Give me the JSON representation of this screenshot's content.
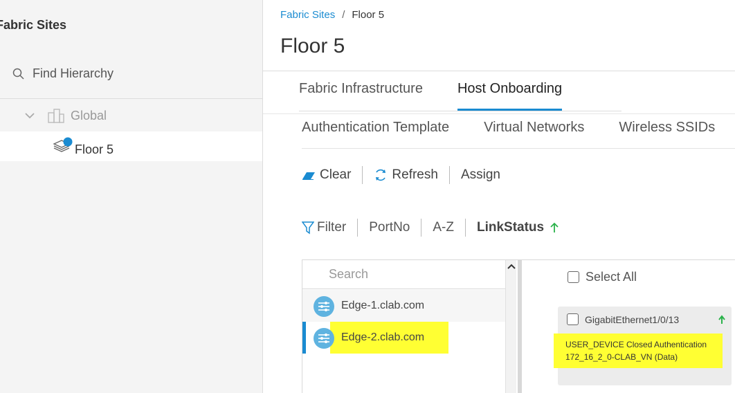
{
  "sidebar": {
    "title": "Fabric Sites",
    "find_label": "Find Hierarchy",
    "tree": {
      "global": "Global",
      "floor": "Floor 5"
    }
  },
  "breadcrumb": {
    "parent": "Fabric Sites",
    "separator": "/",
    "current": "Floor 5"
  },
  "page_title": "Floor 5",
  "tabs": [
    {
      "label": "Fabric Infrastructure",
      "active": false
    },
    {
      "label": "Host Onboarding",
      "active": true
    }
  ],
  "subtabs": [
    "Authentication Template",
    "Virtual Networks",
    "Wireless SSIDs"
  ],
  "actions": {
    "clear": "Clear",
    "refresh": "Refresh",
    "assign": "Assign"
  },
  "filters": {
    "filter": "Filter",
    "port_no": "PortNo",
    "az": "A-Z",
    "link_status": "LinkStatus"
  },
  "devices": {
    "search_placeholder": "Search",
    "items": [
      "Edge-1.clab.com",
      "Edge-2.clab.com"
    ],
    "selected_index": 1
  },
  "ports": {
    "select_all": "Select All",
    "card": {
      "interface": "GigabitEthernet1/0/13",
      "line1": "USER_DEVICE Closed Authentication",
      "line2": "172_16_2_0-CLAB_VN (Data)"
    }
  },
  "colors": {
    "accent": "#1a8bd1",
    "highlight": "#ffff33",
    "up_arrow": "#2ab24a"
  }
}
